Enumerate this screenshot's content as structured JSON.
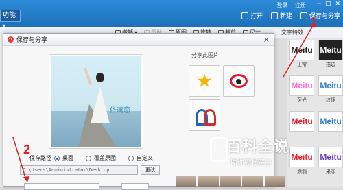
{
  "app": {
    "function_button": "功能",
    "login_links": [
      "登录",
      "注册"
    ],
    "window_controls": [
      "─",
      "□",
      "✕"
    ],
    "top_actions": [
      {
        "label": "打开",
        "icon": "folder-icon"
      },
      {
        "label": "新建",
        "icon": "plus-icon"
      },
      {
        "label": "保存与分享",
        "icon": "save-icon"
      }
    ]
  },
  "toolbar": {
    "items": [
      {
        "label": "撤销",
        "icon": "undo-icon",
        "enabled": true
      },
      {
        "label": "重做",
        "icon": "redo-icon",
        "enabled": false
      },
      {
        "label": "原图",
        "icon": "original-icon",
        "enabled": true
      },
      {
        "label": "旋转",
        "icon": "rotate-icon",
        "enabled": true
      },
      {
        "label": "裁剪",
        "icon": "crop-icon",
        "enabled": true
      },
      {
        "label": "尺寸",
        "icon": "resize-icon",
        "enabled": true
      }
    ],
    "text_effects_label": "文字特效"
  },
  "effects": [
    {
      "thumb": "Meitu",
      "label": "正常",
      "color": "#222222",
      "bg": "#ffffff"
    },
    {
      "thumb": "Meitu",
      "label": "描边",
      "color": "#ffffff",
      "bg": "#222222"
    },
    {
      "thumb": "Meitu",
      "label": "荧光",
      "color": "#ff6fd8",
      "bg": "#ffffff"
    },
    {
      "thumb": "Meitu",
      "label": "纹理",
      "color": "#2a7fd4",
      "bg": "#ffffff"
    },
    {
      "thumb": "Meitu",
      "label": "",
      "color": "#e8202a",
      "bg": "#ffffff"
    },
    {
      "thumb": "Meitu",
      "label": "",
      "color": "#2a7fd4",
      "bg": "#ffffff"
    },
    {
      "thumb": "Meitu",
      "label": "涂鸦",
      "color": "#e8202a",
      "bg": "#ffffff"
    },
    {
      "thumb": "Meitu",
      "label": "果冻",
      "color": "#6a3ec9",
      "bg": "#ffffff"
    }
  ],
  "dialog": {
    "title": "保存与分享",
    "close": "✕",
    "photo_caption": "依澜恋",
    "share_label": "分享此图片",
    "share_targets": [
      "qzone",
      "weibo",
      "renren"
    ],
    "save_path_label": "保存路径",
    "options": [
      {
        "label": "桌面",
        "selected": true
      },
      {
        "label": "覆盖原图",
        "selected": false
      },
      {
        "label": "自定义",
        "selected": false
      }
    ],
    "path_value": "C:\\Users\\Administrator\\Desktop",
    "change_button": "更改"
  },
  "annotations": {
    "one": "1",
    "two": "2",
    "color": "#e02020"
  },
  "watermark": {
    "main": "百科全说",
    "sub": "助你轻松解决"
  }
}
